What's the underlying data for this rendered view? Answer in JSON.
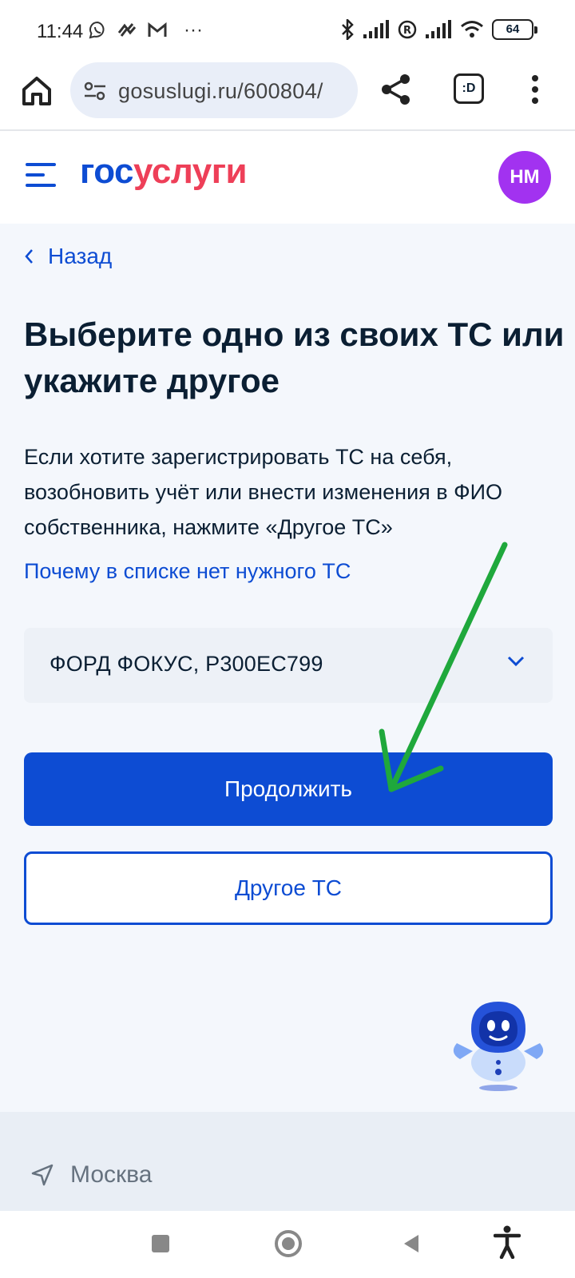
{
  "status": {
    "time": "11:44",
    "battery": "64"
  },
  "browser": {
    "url": "gosuslugi.ru/600804/",
    "tabs_label": ":D"
  },
  "header": {
    "logo_part1": "гос",
    "logo_part2": "услуги",
    "avatar_initials": "НМ"
  },
  "main": {
    "back_label": "Назад",
    "title": "Выберите одно из своих ТС или укажите другое",
    "description": "Если хотите зарегистрировать ТС на себя, возобновить учёт или внести изменения в ФИО собственника, нажмите «Другое ТС»",
    "why_link": "Почему в списке нет нужного ТС",
    "vehicle_select_value": "ФОРД ФОКУС, Р300ЕС799",
    "continue_label": "Продолжить",
    "other_label": "Другое ТС"
  },
  "footer": {
    "location": "Москва"
  },
  "colors": {
    "brand_blue": "#0d4cd3",
    "brand_red": "#ee3f58",
    "avatar": "#a232f0",
    "annotation_arrow": "#1fa83c"
  }
}
